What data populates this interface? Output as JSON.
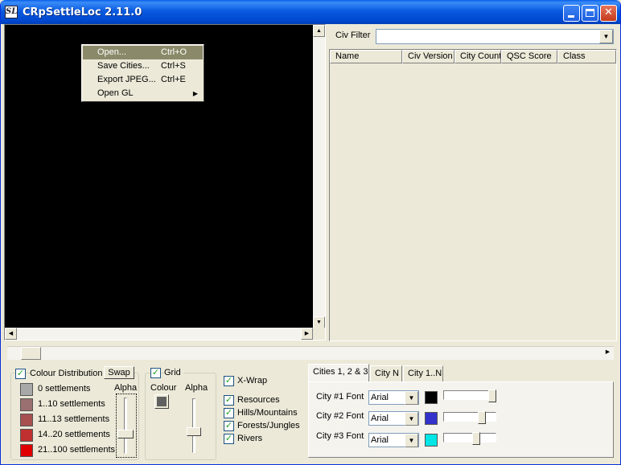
{
  "window": {
    "title": "CRpSettleLoc 2.11.0",
    "icon": "sl-app-icon",
    "icon_text": "SL"
  },
  "menu": {
    "items": [
      {
        "label": "Open...",
        "shortcut": "Ctrl+O",
        "highlighted": true
      },
      {
        "label": "Save Cities...",
        "shortcut": "Ctrl+S"
      },
      {
        "label": "Export JPEG...",
        "shortcut": "Ctrl+E"
      },
      {
        "label": "Open GL",
        "shortcut": "",
        "submenu": true
      }
    ]
  },
  "civ_filter": {
    "label": "Civ Filter",
    "value": ""
  },
  "list": {
    "columns": [
      "Name",
      "Civ Version",
      "City Count",
      "QSC Score",
      "Class"
    ],
    "rows": []
  },
  "colour_distribution": {
    "label": "Colour Distribution",
    "checked": true,
    "swap_label": "Swap",
    "alpha_label": "Alpha",
    "items": [
      {
        "label": "0 settlements",
        "color": "#A8A8A8"
      },
      {
        "label": "1..10 settlements",
        "color": "#9A7070"
      },
      {
        "label": "11..13 settlements",
        "color": "#A65050"
      },
      {
        "label": "14..20 settlements",
        "color": "#C03030"
      },
      {
        "label": "21..100 settlements",
        "color": "#E00000"
      }
    ]
  },
  "grid": {
    "label": "Grid",
    "checked": true,
    "colour_label": "Colour",
    "alpha_label": "Alpha",
    "colour": "#606060"
  },
  "options": {
    "xwrap": {
      "label": "X-Wrap",
      "checked": true
    },
    "resources": {
      "label": "Resources",
      "checked": true
    },
    "hills": {
      "label": "Hills/Mountains",
      "checked": true
    },
    "forests": {
      "label": "Forests/Jungles",
      "checked": true
    },
    "rivers": {
      "label": "Rivers",
      "checked": true
    }
  },
  "tabs": [
    {
      "label": "Cities 1, 2 & 3",
      "active": true
    },
    {
      "label": "City N"
    },
    {
      "label": "City 1..N"
    }
  ],
  "city_fonts": [
    {
      "label": "City #1 Font",
      "font": "Arial",
      "color": "#000000"
    },
    {
      "label": "City #2 Font",
      "font": "Arial",
      "color": "#3333CC"
    },
    {
      "label": "City #3 Font",
      "font": "Arial",
      "color": "#00E5E5"
    }
  ]
}
